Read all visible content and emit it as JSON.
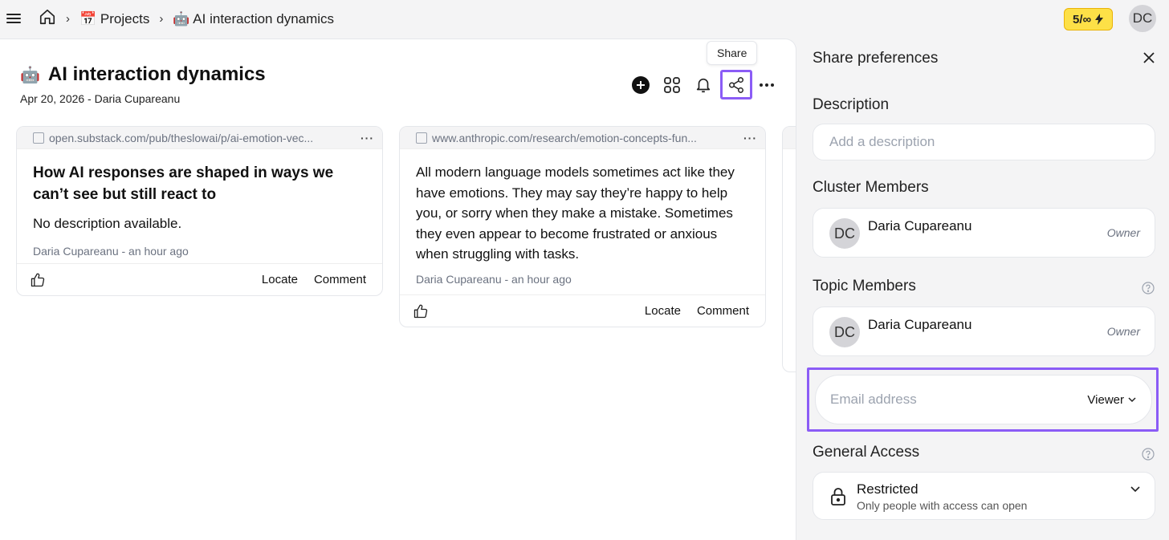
{
  "topbar": {
    "crumbs": [
      {
        "icon": "home-icon"
      },
      {
        "emoji": "📅",
        "label": "Projects"
      },
      {
        "emoji": "🤖",
        "label": "AI interaction dynamics"
      }
    ],
    "quota": "5/∞",
    "avatar": "DC"
  },
  "project": {
    "emoji": "🤖",
    "title": "AI interaction dynamics",
    "subtitle": "Apr 20, 2026 - Daria Cupareanu",
    "share_tooltip": "Share"
  },
  "cards": [
    {
      "url": "open.substack.com/pub/theslowai/p/ai-emotion-vec...",
      "title": "How AI responses are shaped in ways we can’t see but still react to",
      "description": "No description available.",
      "meta": "Daria Cupareanu - an hour ago",
      "locate": "Locate",
      "comment": "Comment"
    },
    {
      "url": "www.anthropic.com/research/emotion-concepts-fun...",
      "title": "",
      "description": "All modern language models sometimes act like they have emotions. They may say they’re happy to help you, or sorry when they make a mistake. Sometimes they even appear to become frustrated or anxious when struggling with tasks.",
      "meta": "Daria Cupareanu - an hour ago",
      "locate": "Locate",
      "comment": "Comment"
    }
  ],
  "share_panel": {
    "title": "Share preferences",
    "description_label": "Description",
    "description_placeholder": "Add a description",
    "cluster_label": "Cluster Members",
    "cluster_members": [
      {
        "initials": "DC",
        "name": "Daria Cupareanu",
        "role": "Owner"
      }
    ],
    "topic_label": "Topic Members",
    "topic_members": [
      {
        "initials": "DC",
        "name": "Daria Cupareanu",
        "role": "Owner"
      }
    ],
    "email_placeholder": "Email address",
    "email_role": "Viewer",
    "general_access_label": "General Access",
    "access_title": "Restricted",
    "access_sub": "Only people with access can open"
  },
  "colors": {
    "accent": "#8b5cf6",
    "quota_bg": "#fde047"
  }
}
